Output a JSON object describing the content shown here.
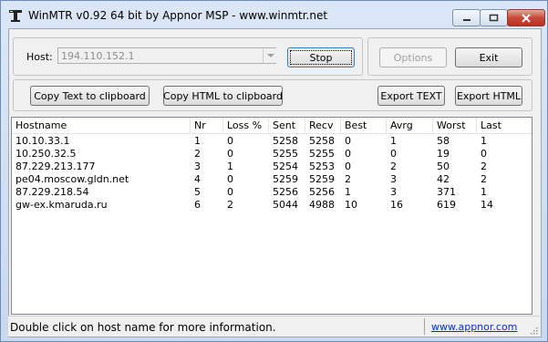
{
  "window": {
    "title": "WinMTR v0.92 64 bit by Appnor MSP - www.winmtr.net"
  },
  "host": {
    "label": "Host:",
    "value": "194.110.152.1"
  },
  "buttons": {
    "stop": "Stop",
    "options": "Options",
    "exit": "Exit",
    "copy_text": "Copy Text to clipboard",
    "copy_html": "Copy HTML to clipboard",
    "export_text": "Export TEXT",
    "export_html": "Export HTML"
  },
  "table": {
    "columns": [
      "Hostname",
      "Nr",
      "Loss %",
      "Sent",
      "Recv",
      "Best",
      "Avrg",
      "Worst",
      "Last"
    ],
    "rows": [
      [
        "10.10.33.1",
        "1",
        "0",
        "5258",
        "5258",
        "0",
        "1",
        "58",
        "1"
      ],
      [
        "10.250.32.5",
        "2",
        "0",
        "5255",
        "5255",
        "0",
        "0",
        "19",
        "0"
      ],
      [
        "87.229.213.177",
        "3",
        "1",
        "5254",
        "5253",
        "0",
        "2",
        "50",
        "2"
      ],
      [
        "pe04.moscow.gldn.net",
        "4",
        "0",
        "5259",
        "5259",
        "2",
        "3",
        "42",
        "2"
      ],
      [
        "87.229.218.54",
        "5",
        "0",
        "5256",
        "5256",
        "1",
        "3",
        "371",
        "1"
      ],
      [
        "gw-ex.kmaruda.ru",
        "6",
        "2",
        "5044",
        "4988",
        "10",
        "16",
        "619",
        "14"
      ]
    ]
  },
  "status": {
    "text": "Double click on host name for more information.",
    "link": "www.appnor.com"
  }
}
